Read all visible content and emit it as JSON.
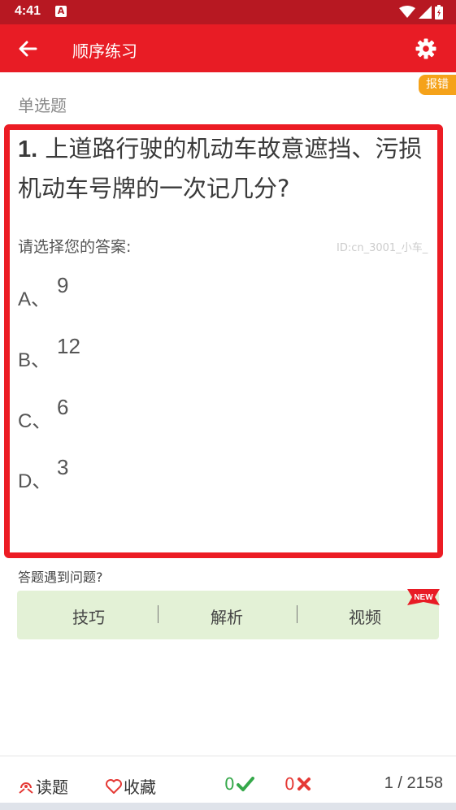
{
  "status_bar": {
    "time": "4:41",
    "notification_icon": "A"
  },
  "app_bar": {
    "title": "顺序练习",
    "back_icon": "arrow-left-icon",
    "settings_icon": "gear-icon"
  },
  "report_label": "报错",
  "question": {
    "type": "单选题",
    "number": "1.",
    "text": "上道路行驶的机动车故意遮挡、污损机动车号牌的一次记几分?",
    "prompt": "请选择您的答案:",
    "id_text": "ID:cn_3001_小车_",
    "options": [
      {
        "letter": "A、",
        "text": "9"
      },
      {
        "letter": "B、",
        "text": "12"
      },
      {
        "letter": "C、",
        "text": "6"
      },
      {
        "letter": "D、",
        "text": "3"
      }
    ]
  },
  "help": {
    "label": "答题遇到问题?",
    "items": [
      "技巧",
      "解析",
      "视频"
    ],
    "new_badge": "NEW"
  },
  "bottom_bar": {
    "read_label": "读题",
    "favorite_label": "收藏",
    "correct_count": "0",
    "wrong_count": "0",
    "progress": "1 / 2158"
  },
  "colors": {
    "accent": "#e81c25",
    "status_bar": "#b71822",
    "badge_orange": "#f5a21a",
    "help_bg": "#e3f1d6",
    "correct_green": "#35a84a",
    "wrong_red": "#e53935"
  }
}
